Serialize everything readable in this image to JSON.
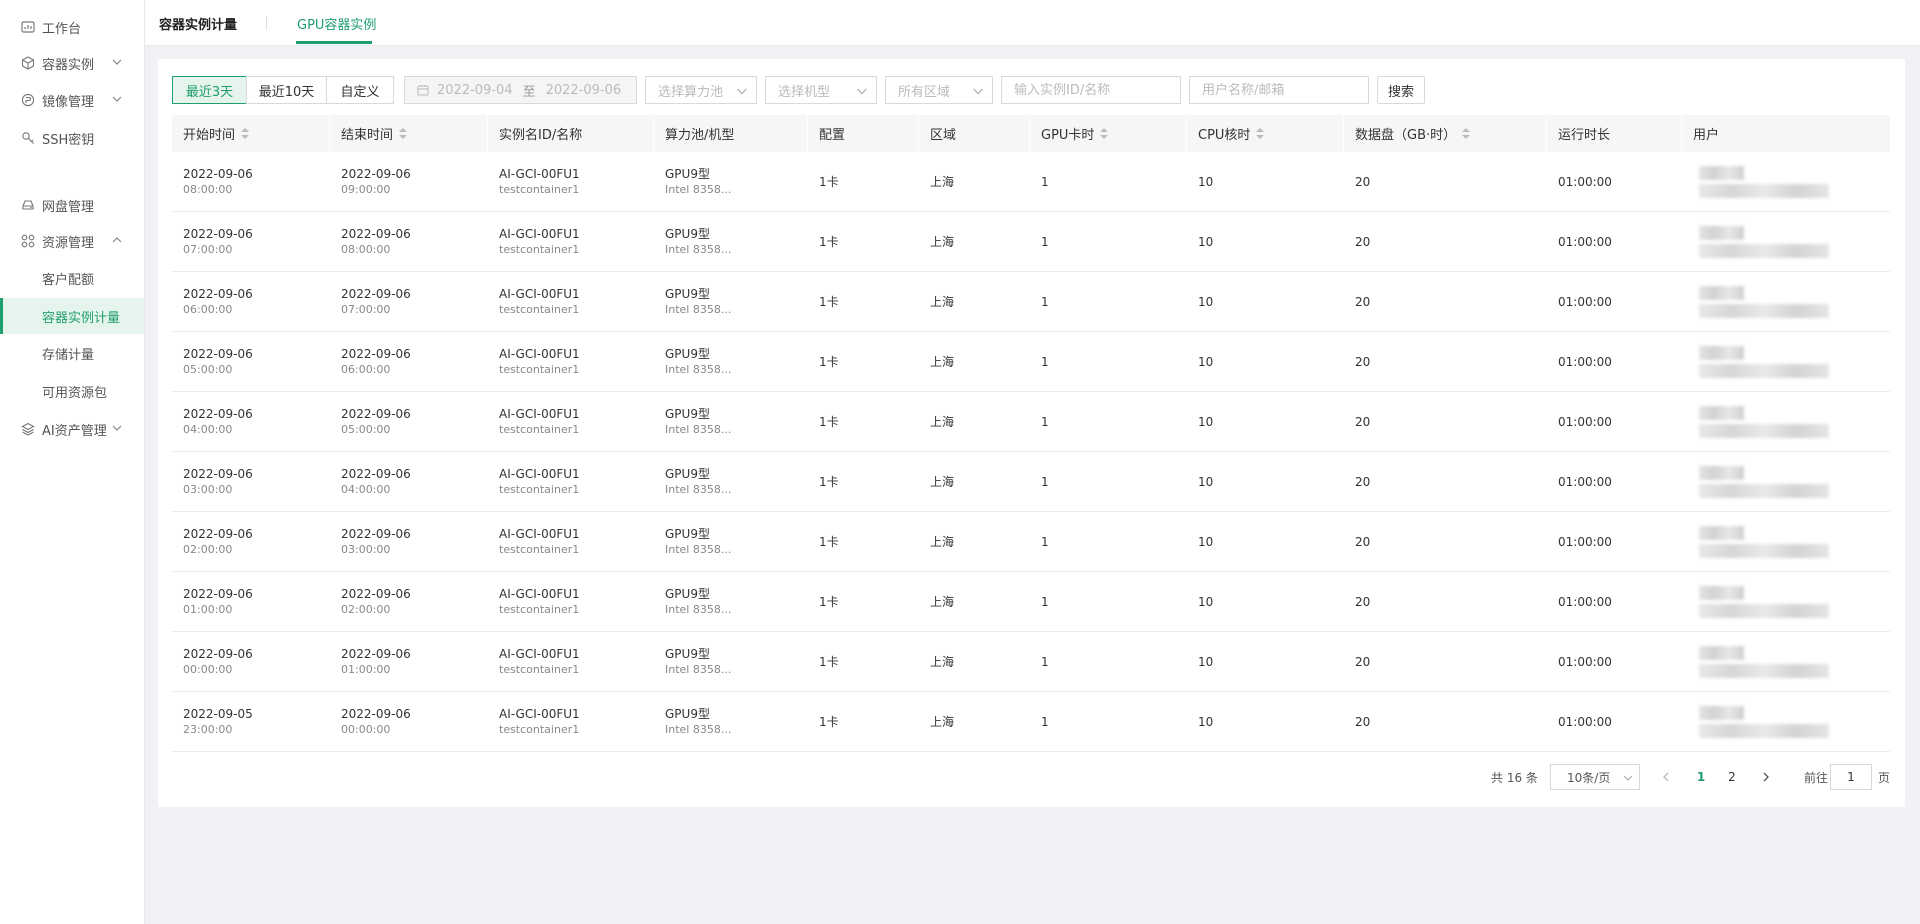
{
  "sidebar": {
    "items": [
      {
        "label": "工作台",
        "icon": "dashboard-icon"
      },
      {
        "label": "容器实例",
        "icon": "cube-icon",
        "expandable": true
      },
      {
        "label": "镜像管理",
        "icon": "image-icon",
        "expandable": true
      },
      {
        "label": "SSH密钥",
        "icon": "key-icon"
      },
      {
        "label": "网盘管理",
        "icon": "drive-icon"
      },
      {
        "label": "资源管理",
        "icon": "grid-icon",
        "expanded": true
      },
      {
        "label": "AI资产管理",
        "icon": "layers-icon",
        "expandable": true
      }
    ],
    "sub_items": [
      "客户配额",
      "容器实例计量",
      "存储计量",
      "可用资源包"
    ],
    "active_sub": "容器实例计量"
  },
  "header": {
    "title": "容器实例计量",
    "tab": "GPU容器实例"
  },
  "filters": {
    "range_buttons": [
      "最近3天",
      "最近10天",
      "自定义"
    ],
    "active_range": "最近3天",
    "date_start": "2022-09-04",
    "date_sep": "至",
    "date_end": "2022-09-06",
    "pool_placeholder": "选择算力池",
    "model_placeholder": "选择机型",
    "region_placeholder": "所有区域",
    "instance_placeholder": "输入实例ID/名称",
    "user_placeholder": "用户名称/邮箱",
    "search_label": "搜索"
  },
  "table": {
    "columns": [
      "开始时间",
      "结束时间",
      "实例名ID/名称",
      "算力池/机型",
      "配置",
      "区域",
      "GPU卡时",
      "CPU核时",
      "数据盘（GB·时）",
      "运行时长",
      "用户"
    ],
    "rows": [
      {
        "start_date": "2022-09-06",
        "start_time": "08:00:00",
        "end_date": "2022-09-06",
        "end_time": "09:00:00",
        "instance_id": "AI-GCI-00FU1",
        "instance_name": "testcontainer1",
        "pool": "GPU9型",
        "model": "Intel 8358...",
        "config": "1卡",
        "region": "上海",
        "gpu_hours": "1",
        "cpu_hours": "10",
        "disk": "20",
        "duration": "01:00:00"
      },
      {
        "start_date": "2022-09-06",
        "start_time": "07:00:00",
        "end_date": "2022-09-06",
        "end_time": "08:00:00",
        "instance_id": "AI-GCI-00FU1",
        "instance_name": "testcontainer1",
        "pool": "GPU9型",
        "model": "Intel 8358...",
        "config": "1卡",
        "region": "上海",
        "gpu_hours": "1",
        "cpu_hours": "10",
        "disk": "20",
        "duration": "01:00:00"
      },
      {
        "start_date": "2022-09-06",
        "start_time": "06:00:00",
        "end_date": "2022-09-06",
        "end_time": "07:00:00",
        "instance_id": "AI-GCI-00FU1",
        "instance_name": "testcontainer1",
        "pool": "GPU9型",
        "model": "Intel 8358...",
        "config": "1卡",
        "region": "上海",
        "gpu_hours": "1",
        "cpu_hours": "10",
        "disk": "20",
        "duration": "01:00:00"
      },
      {
        "start_date": "2022-09-06",
        "start_time": "05:00:00",
        "end_date": "2022-09-06",
        "end_time": "06:00:00",
        "instance_id": "AI-GCI-00FU1",
        "instance_name": "testcontainer1",
        "pool": "GPU9型",
        "model": "Intel 8358...",
        "config": "1卡",
        "region": "上海",
        "gpu_hours": "1",
        "cpu_hours": "10",
        "disk": "20",
        "duration": "01:00:00"
      },
      {
        "start_date": "2022-09-06",
        "start_time": "04:00:00",
        "end_date": "2022-09-06",
        "end_time": "05:00:00",
        "instance_id": "AI-GCI-00FU1",
        "instance_name": "testcontainer1",
        "pool": "GPU9型",
        "model": "Intel 8358...",
        "config": "1卡",
        "region": "上海",
        "gpu_hours": "1",
        "cpu_hours": "10",
        "disk": "20",
        "duration": "01:00:00"
      },
      {
        "start_date": "2022-09-06",
        "start_time": "03:00:00",
        "end_date": "2022-09-06",
        "end_time": "04:00:00",
        "instance_id": "AI-GCI-00FU1",
        "instance_name": "testcontainer1",
        "pool": "GPU9型",
        "model": "Intel 8358...",
        "config": "1卡",
        "region": "上海",
        "gpu_hours": "1",
        "cpu_hours": "10",
        "disk": "20",
        "duration": "01:00:00"
      },
      {
        "start_date": "2022-09-06",
        "start_time": "02:00:00",
        "end_date": "2022-09-06",
        "end_time": "03:00:00",
        "instance_id": "AI-GCI-00FU1",
        "instance_name": "testcontainer1",
        "pool": "GPU9型",
        "model": "Intel 8358...",
        "config": "1卡",
        "region": "上海",
        "gpu_hours": "1",
        "cpu_hours": "10",
        "disk": "20",
        "duration": "01:00:00"
      },
      {
        "start_date": "2022-09-06",
        "start_time": "01:00:00",
        "end_date": "2022-09-06",
        "end_time": "02:00:00",
        "instance_id": "AI-GCI-00FU1",
        "instance_name": "testcontainer1",
        "pool": "GPU9型",
        "model": "Intel 8358...",
        "config": "1卡",
        "region": "上海",
        "gpu_hours": "1",
        "cpu_hours": "10",
        "disk": "20",
        "duration": "01:00:00"
      },
      {
        "start_date": "2022-09-06",
        "start_time": "00:00:00",
        "end_date": "2022-09-06",
        "end_time": "01:00:00",
        "instance_id": "AI-GCI-00FU1",
        "instance_name": "testcontainer1",
        "pool": "GPU9型",
        "model": "Intel 8358...",
        "config": "1卡",
        "region": "上海",
        "gpu_hours": "1",
        "cpu_hours": "10",
        "disk": "20",
        "duration": "01:00:00"
      },
      {
        "start_date": "2022-09-05",
        "start_time": "23:00:00",
        "end_date": "2022-09-06",
        "end_time": "00:00:00",
        "instance_id": "AI-GCI-00FU1",
        "instance_name": "testcontainer1",
        "pool": "GPU9型",
        "model": "Intel 8358...",
        "config": "1卡",
        "region": "上海",
        "gpu_hours": "1",
        "cpu_hours": "10",
        "disk": "20",
        "duration": "01:00:00"
      }
    ]
  },
  "pagination": {
    "total": "共 16 条",
    "page_size": "10条/页",
    "pages": [
      "1",
      "2"
    ],
    "current_page": "1",
    "goto_label": "前往",
    "goto_value": "1",
    "page_suffix": "页"
  },
  "colors": {
    "accent": "#1f9e6e",
    "accent_bg": "#e6f4ee",
    "page_bg": "#f0f2f5"
  }
}
